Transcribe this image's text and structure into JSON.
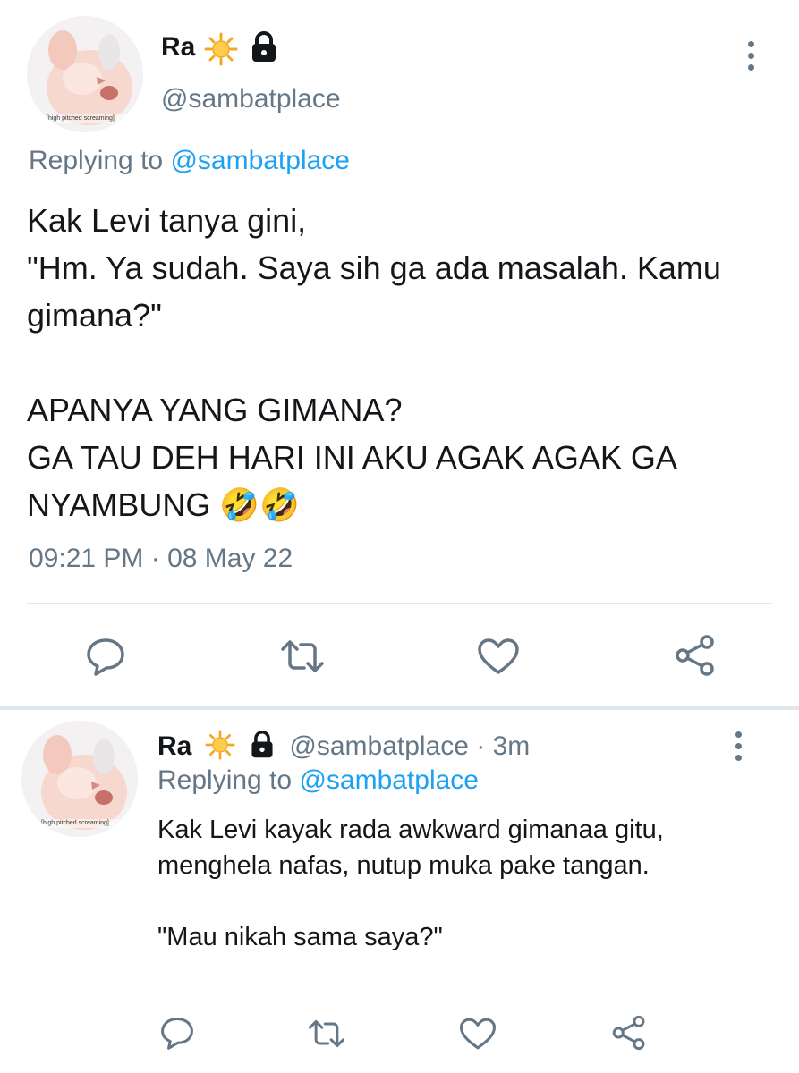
{
  "tweet1": {
    "display_name": "Ra",
    "handle": "@sambatplace",
    "avatar_caption": "[high pitched screaming]",
    "replying_prefix": "Replying to",
    "replying_handle": "@sambatplace",
    "text": "Kak Levi tanya gini,\n\"Hm. Ya sudah. Saya sih ga ada masalah. Kamu gimana?\"\n\nAPANYA YANG GIMANA?\nGA TAU DEH HARI INI AKU AGAK AGAK GA NYAMBUNG 🤣🤣",
    "timestamp": "09:21 PM · 08 May 22",
    "icons": [
      "sun-emoji",
      "lock-icon",
      "more-icon",
      "reply-icon",
      "retweet-icon",
      "like-icon",
      "share-icon"
    ]
  },
  "tweet2": {
    "display_name": "Ra",
    "handle": "@sambatplace",
    "time_ago": "· 3m",
    "avatar_caption": "[high pitched screaming]",
    "replying_prefix": "Replying to",
    "replying_handle": "@sambatplace",
    "text": "Kak Levi kayak rada awkward gimanaa gitu, menghela nafas, nutup muka pake tangan.\n\n\"Mau nikah sama saya?\""
  },
  "colors": {
    "text": "#14171a",
    "muted": "#657786",
    "link": "#1da1f2",
    "divider": "#e1e8ed"
  }
}
